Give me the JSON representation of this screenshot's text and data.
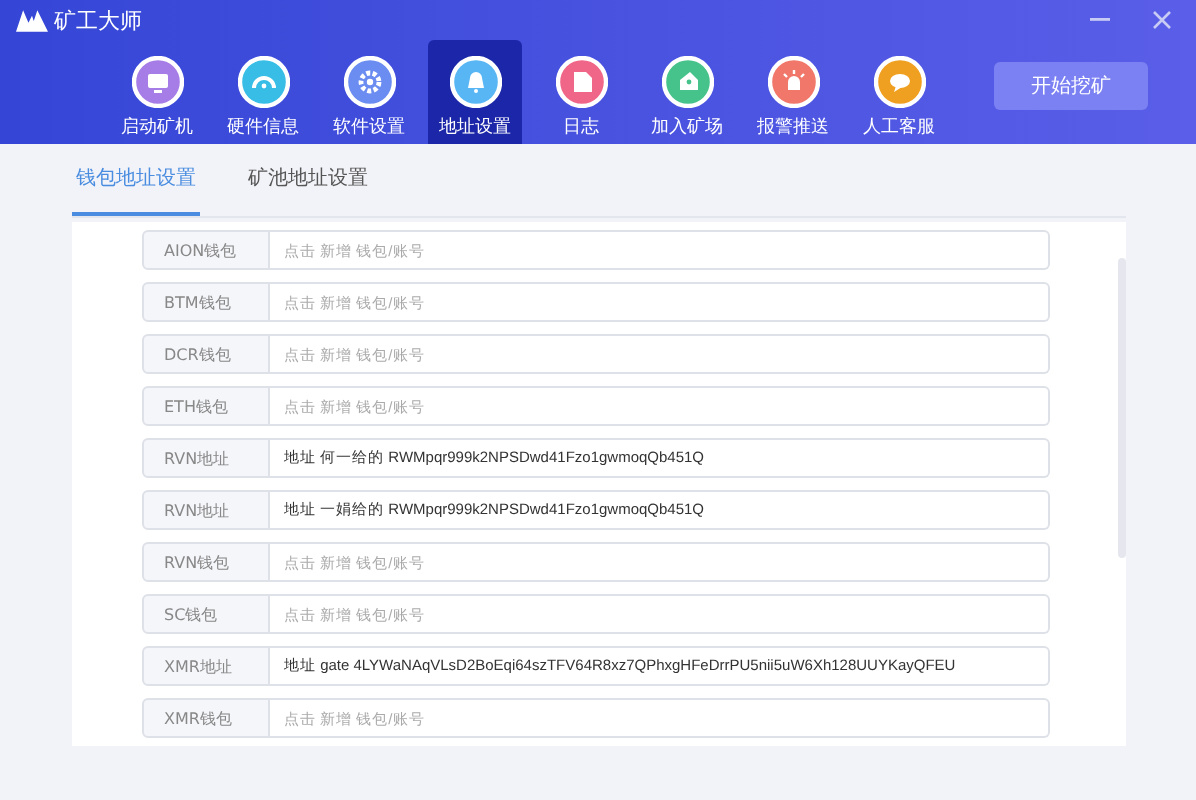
{
  "window": {
    "title": "矿工大师"
  },
  "nav": [
    {
      "label": "启动矿机",
      "selected": false,
      "color": "#a67ce6"
    },
    {
      "label": "硬件信息",
      "selected": false,
      "color": "#37bde6"
    },
    {
      "label": "软件设置",
      "selected": false,
      "color": "#6b8cf0"
    },
    {
      "label": "地址设置",
      "selected": true,
      "color": "#58b6f4"
    },
    {
      "label": "日志",
      "selected": false,
      "color": "#f06688"
    },
    {
      "label": "加入矿场",
      "selected": false,
      "color": "#46c38a"
    },
    {
      "label": "报警推送",
      "selected": false,
      "color": "#f0776a"
    },
    {
      "label": "人工客服",
      "selected": false,
      "color": "#f0a020"
    }
  ],
  "start_button": "开始挖矿",
  "tabs": [
    {
      "label": "钱包地址设置",
      "selected": true
    },
    {
      "label": "矿池地址设置",
      "selected": false
    }
  ],
  "rows": [
    {
      "label": "AION钱包",
      "placeholder": "点击 新增 钱包/账号"
    },
    {
      "label": "BTM钱包",
      "placeholder": "点击 新增 钱包/账号"
    },
    {
      "label": "DCR钱包",
      "placeholder": "点击 新增 钱包/账号"
    },
    {
      "label": "ETH钱包",
      "placeholder": "点击 新增 钱包/账号"
    },
    {
      "label": "RVN地址",
      "value": "地址 何一给的 RWMpqr999k2NPSDwd41Fzo1gwmoqQb451Q"
    },
    {
      "label": "RVN地址",
      "value": "地址 一娟给的 RWMpqr999k2NPSDwd41Fzo1gwmoqQb451Q"
    },
    {
      "label": "RVN钱包",
      "placeholder": "点击 新增 钱包/账号"
    },
    {
      "label": "SC钱包",
      "placeholder": "点击 新增 钱包/账号"
    },
    {
      "label": "XMR地址",
      "value": "地址 gate 4LYWaNAqVLsD2BoEqi64szTFV64R8xz7QPhxgHFeDrrPU5nii5uW6Xh128UUYKayQFEU"
    },
    {
      "label": "XMR钱包",
      "placeholder": "点击 新增 钱包/账号"
    }
  ]
}
